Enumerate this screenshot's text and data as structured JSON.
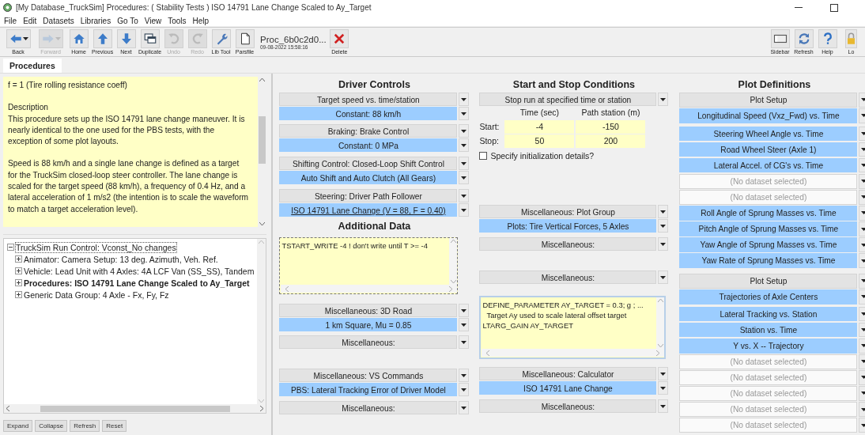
{
  "window": {
    "title": "[My Database_TruckSim] Procedures: ( Stability Tests ) ISO 14791 Lane Change Scaled to Ay_Target"
  },
  "menu": [
    "File",
    "Edit",
    "Datasets",
    "Libraries",
    "Go To",
    "View",
    "Tools",
    "Help"
  ],
  "toolbar": {
    "left": [
      {
        "label": "Back",
        "disabled": false,
        "dropdown": true
      },
      {
        "label": "Forward",
        "disabled": true,
        "dropdown": true
      },
      {
        "label": "Home",
        "disabled": false,
        "dropdown": false
      },
      {
        "label": "Previous",
        "disabled": false,
        "dropdown": false
      },
      {
        "label": "Next",
        "disabled": false,
        "dropdown": false
      },
      {
        "label": "Duplicate",
        "disabled": false,
        "dropdown": false
      },
      {
        "label": "Undo",
        "disabled": true,
        "dropdown": false
      },
      {
        "label": "Redo",
        "disabled": true,
        "dropdown": false
      },
      {
        "label": "Lib Tool",
        "disabled": false,
        "dropdown": false
      },
      {
        "label": "Parsfile",
        "disabled": false,
        "dropdown": false
      }
    ],
    "dataset": {
      "name": "Proc_6b0c2d0...",
      "date": "09-08-2022 15:58:16"
    },
    "delete": {
      "label": "Delete"
    },
    "right": [
      {
        "label": "Sidebar"
      },
      {
        "label": "Refresh"
      },
      {
        "label": "Help"
      },
      {
        "label": "Lo"
      }
    ]
  },
  "tabs": [
    {
      "label": "Procedures",
      "selected": true
    }
  ],
  "notes": [
    "f = 1 (Tire rolling resistance coeff)",
    "Description\nThis procedure sets up the ISO 14791 lane change maneuver. It is nearly identical to the one used for the PBS tests, with the exception of some plot layouts.",
    "Speed is 88 km/h and a single lane change is defined as a target for the TruckSim closed-loop steer controller. The lane change is scaled for the target speed (88 km/h), a frequency of 0.4 Hz, and a lateral acceleration of 1 m/s2 (the intention is to scale the waveform to match a target acceleration level)."
  ],
  "tree": [
    {
      "label": "TruckSim Run Control: Vconst_No changes",
      "expanded": true,
      "selected": true,
      "bold": false,
      "children": [
        {
          "label": "Animator: Camera Setup: 13 deg. Azimuth, Veh. Ref.",
          "expanded": false,
          "selected": false,
          "bold": false
        },
        {
          "label": "Vehicle: Lead Unit with 4 Axles: 4A LCF Van (SS_SS), Tandem",
          "expanded": false,
          "selected": false,
          "bold": false
        },
        {
          "label": "Procedures: ISO 14791 Lane Change Scaled to Ay_Target",
          "expanded": false,
          "selected": false,
          "bold": true
        },
        {
          "label": "Generic Data Group: 4 Axle - Fx, Fy, Fz",
          "expanded": false,
          "selected": false,
          "bold": false
        }
      ]
    }
  ],
  "tree_buttons": [
    "Expand",
    "Collapse",
    "Refresh",
    "Reset"
  ],
  "columns": [
    {
      "blocks": [
        {
          "kind": "heading",
          "text": "Driver Controls"
        },
        {
          "kind": "combos",
          "rows": [
            {
              "label": "Target speed vs. time/station",
              "kind": "header"
            },
            {
              "label": "Constant: 88 km/h",
              "kind": "value"
            }
          ]
        },
        {
          "kind": "combos",
          "rows": [
            {
              "label": "Braking: Brake Control",
              "kind": "header"
            },
            {
              "label": "Constant: 0 MPa",
              "kind": "value"
            }
          ]
        },
        {
          "kind": "combos",
          "rows": [
            {
              "label": "Shifting Control: Closed-Loop Shift Control",
              "kind": "header"
            },
            {
              "label": "Auto Shift and Auto Clutch (All Gears)",
              "kind": "value"
            }
          ]
        },
        {
          "kind": "combos",
          "rows": [
            {
              "label": "Steering: Driver Path Follower",
              "kind": "header"
            },
            {
              "label": "ISO 14791 Lane Change (V = 88, F = 0.40)",
              "kind": "link"
            }
          ]
        },
        {
          "kind": "heading",
          "text": "Additional Data"
        },
        {
          "kind": "notes",
          "focused": true,
          "lines": [
            "TSTART_WRITE -4 ! don't write until T >= -4"
          ]
        },
        {
          "kind": "combos",
          "rows": [
            {
              "label": "Miscellaneous: 3D Road",
              "kind": "header"
            },
            {
              "label": "1 km Square, Mu = 0.85",
              "kind": "value"
            }
          ]
        },
        {
          "kind": "combos",
          "rows": [
            {
              "label": "Miscellaneous:",
              "kind": "header"
            }
          ]
        },
        {
          "kind": "combos",
          "rows": [
            {
              "label": "Miscellaneous: VS Commands",
              "kind": "header"
            },
            {
              "label": "PBS: Lateral Tracking Error of Driver Model",
              "kind": "value"
            }
          ]
        },
        {
          "kind": "combos",
          "rows": [
            {
              "label": "Miscellaneous:",
              "kind": "header"
            }
          ]
        }
      ]
    },
    {
      "blocks": [
        {
          "kind": "heading",
          "text": "Start and Stop Conditions"
        },
        {
          "kind": "combos",
          "rows": [
            {
              "label": "Stop run at specified time or station",
              "kind": "header"
            }
          ]
        },
        {
          "kind": "times",
          "headers": [
            "Time (sec)",
            "Path station (m)"
          ],
          "rows": [
            {
              "label": "Start:",
              "values": [
                "-4",
                "-150"
              ]
            },
            {
              "label": "Stop:",
              "values": [
                "50",
                "200"
              ]
            }
          ]
        },
        {
          "kind": "checkbox",
          "label": "Specify initialization details?",
          "checked": false
        },
        {
          "kind": "combos",
          "rows": [
            {
              "label": "Miscellaneous: Plot Group",
              "kind": "header"
            },
            {
              "label": "Plots: Tire Vertical Forces, 5 Axles",
              "kind": "value"
            }
          ]
        },
        {
          "kind": "combos",
          "rows": [
            {
              "label": "Miscellaneous:",
              "kind": "header"
            }
          ]
        },
        {
          "kind": "combos",
          "rows": [
            {
              "label": "Miscellaneous:",
              "kind": "header"
            }
          ]
        },
        {
          "kind": "notes",
          "focused": false,
          "lines": [
            "DEFINE_PARAMETER AY_TARGET = 0.3; g ; ...",
            "  Target Ay used to scale lateral offset target",
            "LTARG_GAIN AY_TARGET"
          ]
        },
        {
          "kind": "combos",
          "rows": [
            {
              "label": "Miscellaneous: Calculator",
              "kind": "header"
            },
            {
              "label": "ISO 14791 Lane Change",
              "kind": "value"
            }
          ]
        },
        {
          "kind": "combos",
          "rows": [
            {
              "label": "Miscellaneous:",
              "kind": "header"
            }
          ]
        }
      ]
    },
    {
      "blocks": [
        {
          "kind": "heading",
          "text": "Plot Definitions"
        },
        {
          "kind": "combos",
          "rows": [
            {
              "label": "Plot Setup",
              "kind": "header"
            },
            {
              "label": "Longitudinal Speed (Vxz_Fwd) vs. Time",
              "kind": "value"
            }
          ]
        },
        {
          "kind": "combos",
          "rows": [
            {
              "label": "Steering Wheel Angle vs. Time",
              "kind": "value"
            },
            {
              "label": "Road Wheel Steer (Axle 1)",
              "kind": "value"
            },
            {
              "label": "Lateral Accel. of CG's vs. Time",
              "kind": "value"
            },
            {
              "label": "(No dataset selected)",
              "kind": "empty"
            },
            {
              "label": "(No dataset selected)",
              "kind": "empty"
            },
            {
              "label": "Roll Angle of Sprung Masses vs. Time",
              "kind": "value"
            },
            {
              "label": "Pitch Angle of Sprung Masses vs. Time",
              "kind": "value"
            },
            {
              "label": "Yaw Angle of Sprung Masses vs. Time",
              "kind": "value"
            },
            {
              "label": "Yaw Rate of Sprung Masses vs. Time",
              "kind": "value"
            }
          ]
        },
        {
          "kind": "combos",
          "rows": [
            {
              "label": "Plot Setup",
              "kind": "header"
            },
            {
              "label": "Trajectories of Axle Centers",
              "kind": "value"
            }
          ]
        },
        {
          "kind": "combos",
          "rows": [
            {
              "label": "Lateral Tracking vs. Station",
              "kind": "value"
            },
            {
              "label": "Station vs. Time",
              "kind": "value"
            },
            {
              "label": "Y vs. X -- Trajectory",
              "kind": "value"
            },
            {
              "label": "(No dataset selected)",
              "kind": "empty"
            },
            {
              "label": "(No dataset selected)",
              "kind": "empty"
            },
            {
              "label": "(No dataset selected)",
              "kind": "empty"
            },
            {
              "label": "(No dataset selected)",
              "kind": "empty"
            },
            {
              "label": "(No dataset selected)",
              "kind": "empty"
            }
          ]
        }
      ]
    }
  ]
}
